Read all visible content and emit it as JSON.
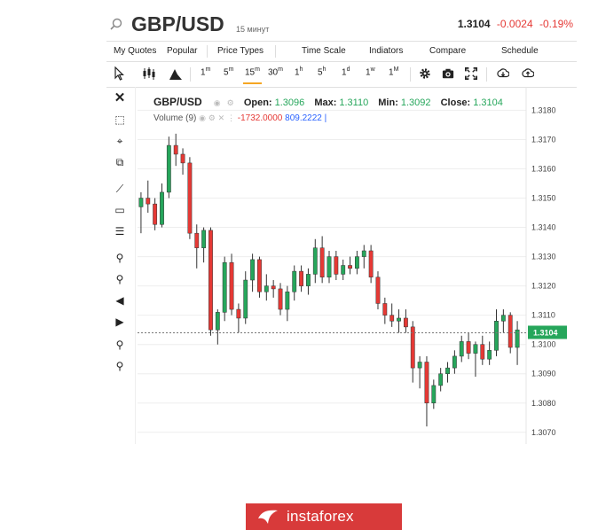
{
  "header": {
    "symbol": "GBP/USD",
    "interval": "15 минут",
    "last_price": "1.3104",
    "change": "-0.0024",
    "change_pct": "-0.19%"
  },
  "menu": [
    "My Quotes",
    "Popular",
    "Price Types",
    "Time Scale",
    "Indiators",
    "Compare",
    "Schedule"
  ],
  "toolbar": {
    "periods": [
      {
        "main": "1",
        "sup": "m"
      },
      {
        "main": "5",
        "sup": "m"
      },
      {
        "main": "15",
        "sup": "m"
      },
      {
        "main": "30",
        "sup": "m"
      },
      {
        "main": "1",
        "sup": "h"
      },
      {
        "main": "5",
        "sup": "h"
      },
      {
        "main": "1",
        "sup": "d"
      },
      {
        "main": "1",
        "sup": "w"
      },
      {
        "main": "1",
        "sup": "M"
      }
    ],
    "active_period": 2
  },
  "legend": {
    "symbol": "GBP/USD",
    "open_label": "Open:",
    "open": "1.3096",
    "max_label": "Max:",
    "max": "1.3110",
    "min_label": "Min:",
    "min": "1.3092",
    "close_label": "Close:",
    "close": "1.3104",
    "volume_label": "Volume (9)",
    "volume_neg": "-1732.0000",
    "volume_pos": "809.2222"
  },
  "watermark": {
    "text": "instaforex"
  },
  "chart_data": {
    "type": "candlestick",
    "y_ticks": [
      "1.3180",
      "1.3170",
      "1.3160",
      "1.3150",
      "1.3140",
      "1.3130",
      "1.3120",
      "1.3110",
      "1.3100",
      "1.3090",
      "1.3080",
      "1.3070"
    ],
    "ylim": [
      1.3066,
      1.3188
    ],
    "current_price_label": "1.3104",
    "current_price": 1.3104,
    "colors": {
      "up": "#26a65b",
      "down": "#e53935",
      "grid": "#eeeeee"
    },
    "candles": [
      {
        "o": 1.3147,
        "h": 1.3152,
        "l": 1.3138,
        "c": 1.315
      },
      {
        "o": 1.315,
        "h": 1.3156,
        "l": 1.3145,
        "c": 1.3148
      },
      {
        "o": 1.3148,
        "h": 1.315,
        "l": 1.3139,
        "c": 1.3141
      },
      {
        "o": 1.3141,
        "h": 1.3155,
        "l": 1.314,
        "c": 1.3152
      },
      {
        "o": 1.3152,
        "h": 1.3171,
        "l": 1.315,
        "c": 1.3168
      },
      {
        "o": 1.3168,
        "h": 1.3172,
        "l": 1.3161,
        "c": 1.3165
      },
      {
        "o": 1.3165,
        "h": 1.3167,
        "l": 1.3158,
        "c": 1.3162
      },
      {
        "o": 1.3162,
        "h": 1.3164,
        "l": 1.3136,
        "c": 1.3138
      },
      {
        "o": 1.3138,
        "h": 1.3141,
        "l": 1.3126,
        "c": 1.3133
      },
      {
        "o": 1.3133,
        "h": 1.314,
        "l": 1.3128,
        "c": 1.3139
      },
      {
        "o": 1.3139,
        "h": 1.314,
        "l": 1.3103,
        "c": 1.3105
      },
      {
        "o": 1.3105,
        "h": 1.3112,
        "l": 1.31,
        "c": 1.3111
      },
      {
        "o": 1.3111,
        "h": 1.313,
        "l": 1.3108,
        "c": 1.3128
      },
      {
        "o": 1.3128,
        "h": 1.3131,
        "l": 1.311,
        "c": 1.3112
      },
      {
        "o": 1.3112,
        "h": 1.3114,
        "l": 1.3104,
        "c": 1.3109
      },
      {
        "o": 1.3109,
        "h": 1.3125,
        "l": 1.3107,
        "c": 1.3122
      },
      {
        "o": 1.3122,
        "h": 1.3131,
        "l": 1.3118,
        "c": 1.3129
      },
      {
        "o": 1.3129,
        "h": 1.313,
        "l": 1.3116,
        "c": 1.3118
      },
      {
        "o": 1.3118,
        "h": 1.3124,
        "l": 1.3115,
        "c": 1.312
      },
      {
        "o": 1.312,
        "h": 1.3122,
        "l": 1.3116,
        "c": 1.3119
      },
      {
        "o": 1.3119,
        "h": 1.3121,
        "l": 1.311,
        "c": 1.3112
      },
      {
        "o": 1.3112,
        "h": 1.312,
        "l": 1.3108,
        "c": 1.3118
      },
      {
        "o": 1.3118,
        "h": 1.3127,
        "l": 1.3115,
        "c": 1.3125
      },
      {
        "o": 1.3125,
        "h": 1.3127,
        "l": 1.3118,
        "c": 1.312
      },
      {
        "o": 1.312,
        "h": 1.3126,
        "l": 1.3117,
        "c": 1.3124
      },
      {
        "o": 1.3124,
        "h": 1.3136,
        "l": 1.3121,
        "c": 1.3133
      },
      {
        "o": 1.3133,
        "h": 1.3137,
        "l": 1.3121,
        "c": 1.3123
      },
      {
        "o": 1.3123,
        "h": 1.3132,
        "l": 1.3121,
        "c": 1.313
      },
      {
        "o": 1.313,
        "h": 1.3132,
        "l": 1.3122,
        "c": 1.3124
      },
      {
        "o": 1.3124,
        "h": 1.3129,
        "l": 1.3122,
        "c": 1.3127
      },
      {
        "o": 1.3127,
        "h": 1.313,
        "l": 1.3124,
        "c": 1.3126
      },
      {
        "o": 1.3126,
        "h": 1.3132,
        "l": 1.3124,
        "c": 1.313
      },
      {
        "o": 1.313,
        "h": 1.3134,
        "l": 1.3126,
        "c": 1.3132
      },
      {
        "o": 1.3132,
        "h": 1.3134,
        "l": 1.3121,
        "c": 1.3123
      },
      {
        "o": 1.3123,
        "h": 1.3125,
        "l": 1.3112,
        "c": 1.3114
      },
      {
        "o": 1.3114,
        "h": 1.3116,
        "l": 1.3107,
        "c": 1.311
      },
      {
        "o": 1.311,
        "h": 1.3114,
        "l": 1.3106,
        "c": 1.3108
      },
      {
        "o": 1.3108,
        "h": 1.3112,
        "l": 1.3104,
        "c": 1.3109
      },
      {
        "o": 1.3109,
        "h": 1.3112,
        "l": 1.3104,
        "c": 1.3106
      },
      {
        "o": 1.3106,
        "h": 1.3108,
        "l": 1.3087,
        "c": 1.3092
      },
      {
        "o": 1.3092,
        "h": 1.3096,
        "l": 1.3085,
        "c": 1.3094
      },
      {
        "o": 1.3094,
        "h": 1.3096,
        "l": 1.3072,
        "c": 1.308
      },
      {
        "o": 1.308,
        "h": 1.3088,
        "l": 1.3078,
        "c": 1.3086
      },
      {
        "o": 1.3086,
        "h": 1.3092,
        "l": 1.3084,
        "c": 1.309
      },
      {
        "o": 1.309,
        "h": 1.3094,
        "l": 1.3087,
        "c": 1.3092
      },
      {
        "o": 1.3092,
        "h": 1.3098,
        "l": 1.309,
        "c": 1.3096
      },
      {
        "o": 1.3096,
        "h": 1.3103,
        "l": 1.3094,
        "c": 1.3101
      },
      {
        "o": 1.3101,
        "h": 1.3104,
        "l": 1.3095,
        "c": 1.3097
      },
      {
        "o": 1.3097,
        "h": 1.3101,
        "l": 1.3089,
        "c": 1.31
      },
      {
        "o": 1.31,
        "h": 1.3103,
        "l": 1.3093,
        "c": 1.3095
      },
      {
        "o": 1.3095,
        "h": 1.3101,
        "l": 1.3093,
        "c": 1.3098
      },
      {
        "o": 1.3098,
        "h": 1.3112,
        "l": 1.3096,
        "c": 1.3108
      },
      {
        "o": 1.3108,
        "h": 1.3112,
        "l": 1.3104,
        "c": 1.311
      },
      {
        "o": 1.311,
        "h": 1.3111,
        "l": 1.3097,
        "c": 1.3099
      },
      {
        "o": 1.3099,
        "h": 1.3108,
        "l": 1.3093,
        "c": 1.3105
      }
    ]
  }
}
